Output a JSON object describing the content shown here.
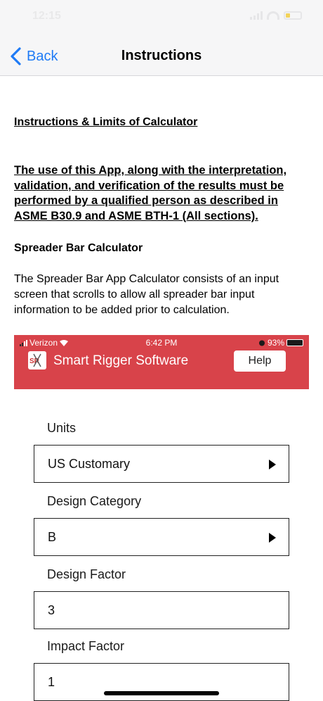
{
  "status_bar": {
    "time": "12:15"
  },
  "nav": {
    "back_label": "Back",
    "title": "Instructions"
  },
  "content": {
    "heading": "Instructions & Limits of Calculator",
    "warning": "The use of this App, along with the interpretation, validation, and verification of the results must be performed by a qualified person as described in ASME B30.9 and ASME BTH-1 (All sections).",
    "section_title": "Spreader Bar Calculator",
    "description": "The Spreader Bar App Calculator consists of an input screen that scrolls to allow all spreader bar input information to be added prior to calculation."
  },
  "embedded_screenshot": {
    "carrier": "Verizon",
    "time": "6:42 PM",
    "battery": "93%",
    "brand": "Smart Rigger Software",
    "logo_text": "SR",
    "help_label": "Help",
    "background_color": "#d8434a"
  },
  "form": {
    "fields": [
      {
        "label": "Units",
        "value": "US Customary",
        "has_dropdown": true
      },
      {
        "label": "Design Category",
        "value": "B",
        "has_dropdown": true
      },
      {
        "label": "Design Factor",
        "value": "3",
        "has_dropdown": false
      },
      {
        "label": "Impact Factor",
        "value": "1",
        "has_dropdown": false
      }
    ]
  },
  "colors": {
    "accent": "#1f7bf6",
    "nav_background": "#f6f6f7"
  }
}
